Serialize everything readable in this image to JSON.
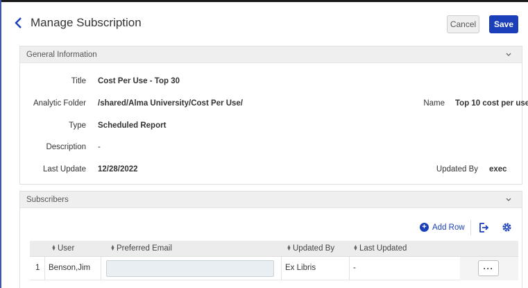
{
  "header": {
    "title": "Manage Subscription",
    "cancel_label": "Cancel",
    "save_label": "Save"
  },
  "general_info": {
    "section_title": "General Information",
    "title_label": "Title",
    "title_value": "Cost Per Use - Top 30",
    "folder_label": "Analytic Folder",
    "folder_value": "/shared/Alma University/Cost Per Use/",
    "name_label": "Name",
    "name_value": "Top 10 cost per use",
    "type_label": "Type",
    "type_value": "Scheduled Report",
    "description_label": "Description",
    "description_value": "-",
    "last_update_label": "Last Update",
    "last_update_value": "12/28/2022",
    "updated_by_label": "Updated By",
    "updated_by_value": "exec"
  },
  "subscribers": {
    "section_title": "Subscribers",
    "add_row_label": "Add Row",
    "columns": [
      "User",
      "Preferred Email",
      "Updated By",
      "Last Updated"
    ],
    "rows": [
      {
        "index": "1",
        "user": "Benson,Jim",
        "email": "",
        "updated_by": "Ex Libris",
        "last_updated": "-",
        "actions": "···"
      }
    ]
  },
  "colors": {
    "accent": "#1a3fb8",
    "panel_header_bg": "#efefef",
    "grid_header_bg": "#ececec"
  },
  "icons": [
    "chevron-left-icon",
    "chevron-down-icon",
    "plus-circle-icon",
    "export-icon",
    "gear-icon",
    "sort-icon",
    "more-icon"
  ]
}
